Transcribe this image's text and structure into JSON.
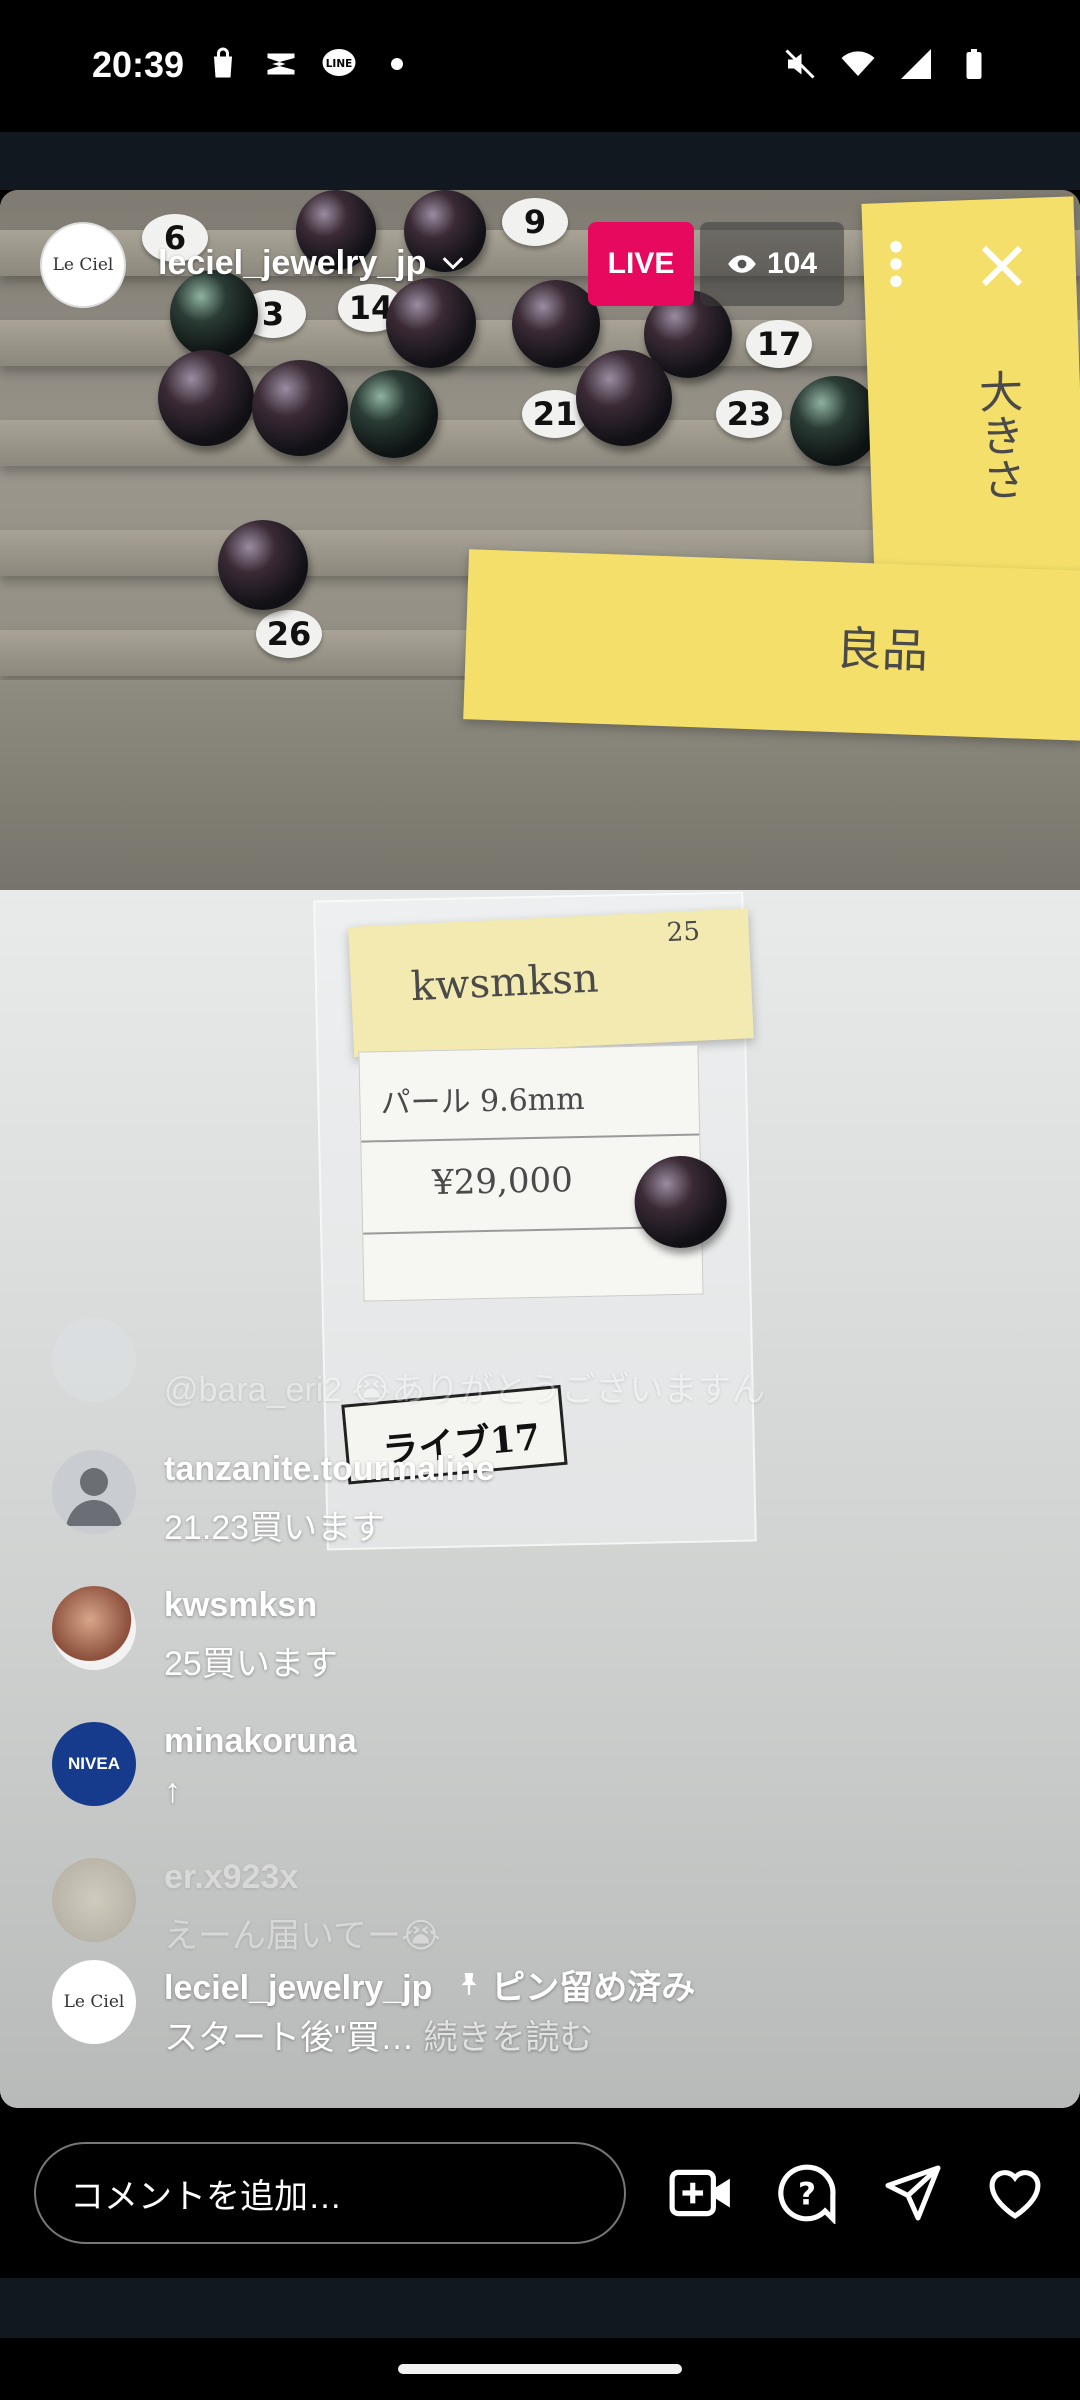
{
  "status_bar": {
    "time": "20:39",
    "left_icons": [
      "shopping-bag-icon",
      "capcut-icon",
      "line-icon",
      "dot-icon"
    ],
    "right_icons": [
      "mute-icon",
      "wifi-icon",
      "signal-icon",
      "battery-icon"
    ]
  },
  "live": {
    "host": {
      "username": "leciel_jewelry_jp",
      "avatar_text": "Le Ciel"
    },
    "badge": "LIVE",
    "viewer_count": "104"
  },
  "comments": [
    {
      "user": "",
      "text": "@bara_eri2 😭ありがとうございますん",
      "faded": true
    },
    {
      "user": "tanzanite.tourmaline",
      "text": "21.23買います",
      "faded": false
    },
    {
      "user": "kwsmksn",
      "text": "25買います",
      "faded": false
    },
    {
      "user": "minakoruna",
      "text": "↑",
      "avatar_text": "NIVEA",
      "faded": false
    },
    {
      "user": "er.x923x",
      "text": "えーん届いてー😭",
      "faded": true
    }
  ],
  "pinned": {
    "user": "leciel_jewelry_jp",
    "pin_label": "ピン留め済み",
    "text": "スタート後\"買…",
    "read_more": "続きを読む",
    "avatar_text": "Le Ciel"
  },
  "composer": {
    "placeholder": "コメントを追加…"
  },
  "video_scene": {
    "sticky_note_text": "良品",
    "sticky_note_vertical": "大きさ",
    "label_name": "kwsmksn",
    "label_number": "25",
    "label_line1": "パール 9.6mm",
    "label_line2": "¥29,000",
    "tag_text": "ライブ17",
    "discs": [
      "6",
      "9",
      "17",
      "3",
      "14",
      "21",
      "23",
      "26"
    ]
  }
}
